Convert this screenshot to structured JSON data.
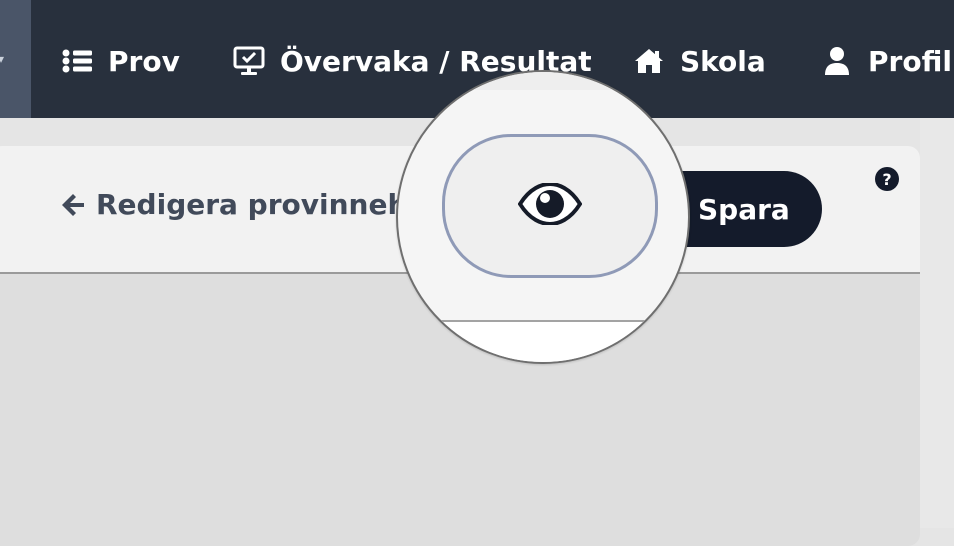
{
  "nav": {
    "items": [
      {
        "label": "Prov",
        "icon": "list-icon"
      },
      {
        "label": "Övervaka / Resultat",
        "icon": "monitor-check-icon"
      },
      {
        "label": "Skola",
        "icon": "home-icon"
      },
      {
        "label": "Profil",
        "icon": "user-icon"
      }
    ]
  },
  "editor": {
    "back_label": "Redigera provinnehå",
    "save_label": "Spara",
    "help_symbol": "?"
  },
  "magnifier": {
    "focused_button_icon": "eye-icon"
  },
  "colors": {
    "topbar": "#28303d",
    "save_button": "#141b2b",
    "preview_border": "#8f9ab7"
  }
}
